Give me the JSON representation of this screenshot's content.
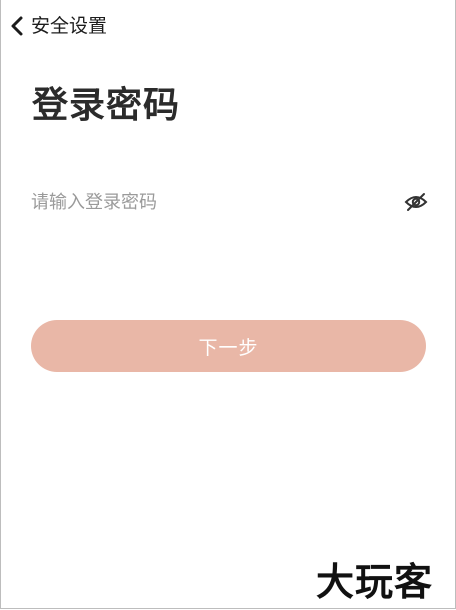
{
  "nav": {
    "back_icon": "chevron-left-icon",
    "title": "安全设置"
  },
  "page": {
    "title": "登录密码"
  },
  "password": {
    "placeholder": "请输入登录密码",
    "value": "",
    "visibility_icon": "eye-hidden-icon"
  },
  "next_button": {
    "label": "下一步",
    "enabled": false
  },
  "watermark": {
    "text": "大玩客"
  },
  "colors": {
    "background": "#ffffff",
    "button_fill": "#e9b7a7",
    "button_text": "#ffffff",
    "placeholder": "#9a9a9a",
    "title": "#2b2b2b"
  }
}
